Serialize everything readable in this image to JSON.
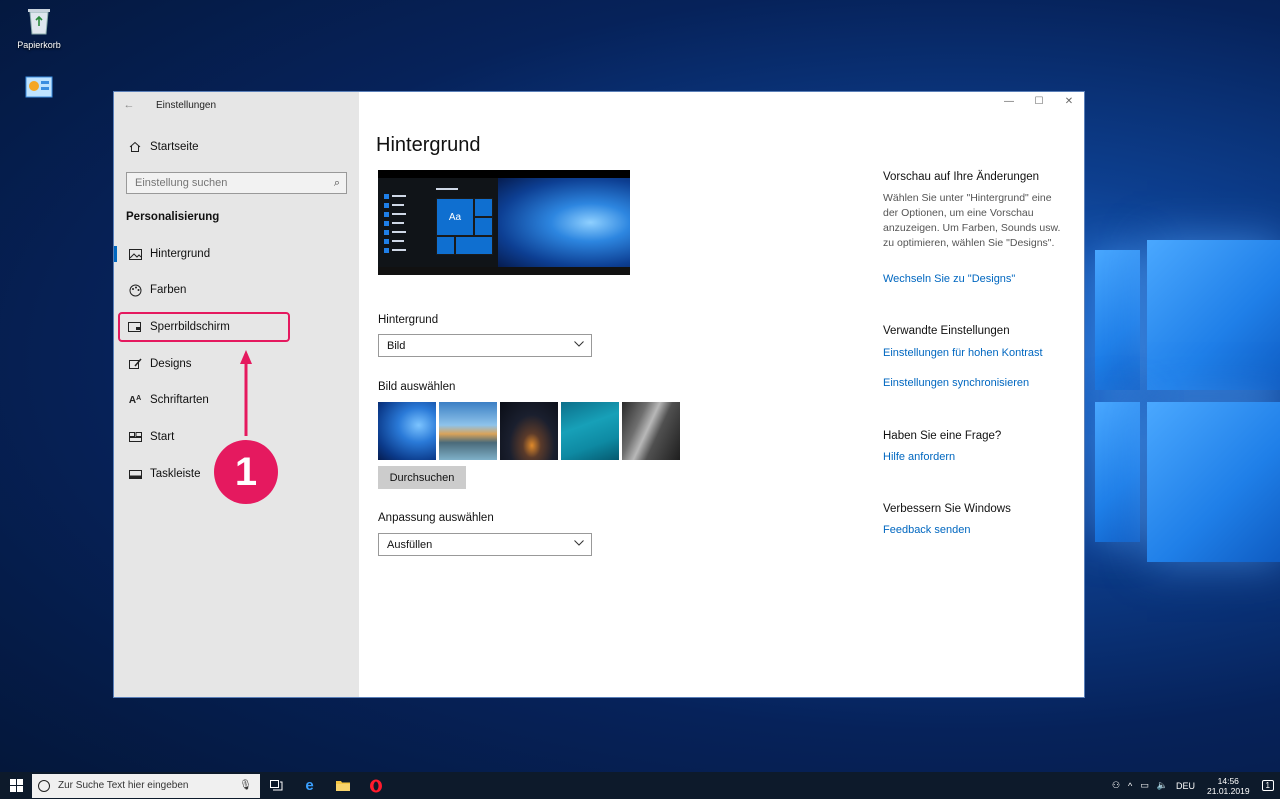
{
  "desktop": {
    "recycle_bin_label": "Papierkorb"
  },
  "window": {
    "title": "Einstellungen",
    "controls": {
      "minimize": "—",
      "maximize": "☐",
      "close": "✕"
    }
  },
  "sidebar": {
    "home_label": "Startseite",
    "search_placeholder": "Einstellung suchen",
    "section_title": "Personalisierung",
    "items": [
      {
        "label": "Hintergrund",
        "icon": "image-icon",
        "active": true
      },
      {
        "label": "Farben",
        "icon": "palette-icon"
      },
      {
        "label": "Sperrbildschirm",
        "icon": "lockscreen-icon"
      },
      {
        "label": "Designs",
        "icon": "brush-icon"
      },
      {
        "label": "Schriftarten",
        "icon": "font-icon"
      },
      {
        "label": "Start",
        "icon": "start-icon"
      },
      {
        "label": "Taskleiste",
        "icon": "taskbar-icon"
      }
    ],
    "annotation_number": "1"
  },
  "main": {
    "page_title": "Hintergrund",
    "preview_tile_text": "Aa",
    "background_label": "Hintergrund",
    "background_value": "Bild",
    "choose_image_label": "Bild auswählen",
    "browse_button": "Durchsuchen",
    "fit_label": "Anpassung auswählen",
    "fit_value": "Ausfüllen"
  },
  "right": {
    "preview_heading": "Vorschau auf Ihre Änderungen",
    "preview_text": "Wählen Sie unter \"Hintergrund\" eine der Optionen, um eine Vorschau anzuzeigen. Um Farben, Sounds usw. zu optimieren, wählen Sie \"Designs\".",
    "designs_link": "Wechseln Sie zu \"Designs\"",
    "related_heading": "Verwandte Einstellungen",
    "contrast_link": "Einstellungen für hohen Kontrast",
    "sync_link": "Einstellungen synchronisieren",
    "question_heading": "Haben Sie eine Frage?",
    "help_link": "Hilfe anfordern",
    "improve_heading": "Verbessern Sie Windows",
    "feedback_link": "Feedback senden"
  },
  "taskbar": {
    "search_placeholder": "Zur Suche Text hier eingeben",
    "language": "DEU",
    "time": "14:56",
    "date": "21.01.2019",
    "notifications": "1"
  },
  "colors": {
    "accent": "#0067c0",
    "annotation": "#e5195f"
  }
}
